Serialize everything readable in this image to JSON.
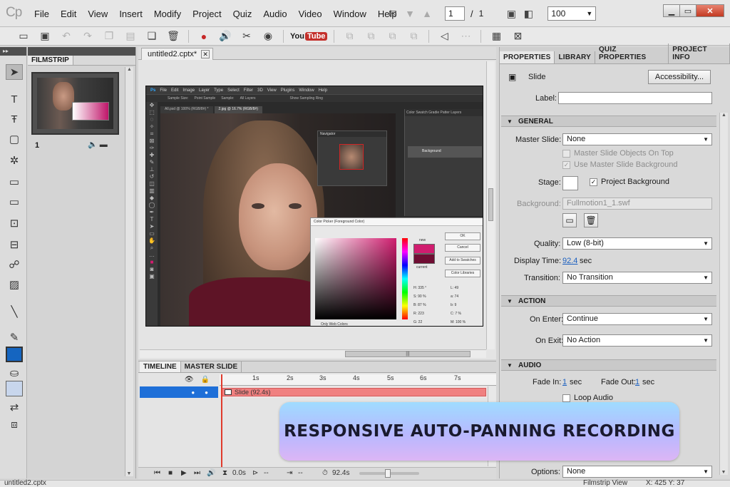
{
  "app": {
    "logo": "Cp",
    "menu": [
      "File",
      "Edit",
      "View",
      "Insert",
      "Modify",
      "Project",
      "Quiz",
      "Audio",
      "Video",
      "Window",
      "Help"
    ],
    "page_current": "1",
    "page_separator": "/",
    "page_total": "1",
    "zoom_value": "100"
  },
  "toolbar": {
    "youtube_label": "You",
    "youtube_badge": "Tube"
  },
  "filmstrip": {
    "tab_label": "FILMSTRIP",
    "slide_number": "1"
  },
  "document": {
    "tab_label": "untitled2.cptx*",
    "close_glyph": "✕",
    "hscroll_grip": "|||"
  },
  "screenshot": {
    "ps_menu": [
      "File",
      "Edit",
      "Image",
      "Layer",
      "Type",
      "Select",
      "Filter",
      "3D",
      "View",
      "Plugins",
      "Window",
      "Help"
    ],
    "ps_options": [
      "Sample Size:",
      "Point Sample",
      "Sample:",
      "All Layers",
      "Show Sampling Ring"
    ],
    "ps_doc_tabs": [
      "All.psd @ 100% (RGB/8#) *",
      "2.jpg @ 16.7% (RGB/8#)"
    ],
    "navigator_title": "Navigator",
    "panel_tabs": "Color  Swatch  Gradie  Patter  Layers",
    "layer_name": "Background",
    "picker_title": "Color Picker (Foreground Color)",
    "picker_new": "new",
    "picker_current": "current",
    "picker_buttons": [
      "OK",
      "Cancel",
      "Add to Swatches",
      "Color Libraries"
    ],
    "picker_fields": [
      "H: 335 °",
      "S: 90 %",
      "B: 87 %",
      "R: 223",
      "G: 22"
    ],
    "picker_fields_right": [
      "L: 49",
      "a: 74",
      "b: 9",
      "C: 7 %",
      "M: 100 %"
    ],
    "picker_web": "Only Web Colors",
    "accent_color": "#d01d6f"
  },
  "timeline": {
    "tabs": [
      "TIMELINE",
      "MASTER SLIDE"
    ],
    "ticks": [
      "1s",
      "2s",
      "3s",
      "4s",
      "5s",
      "6s",
      "7s"
    ],
    "slide_bar_label": "Slide (92.4s)",
    "time_start": "0.0s",
    "time_elapsed": "--",
    "time_end": "--",
    "duration": "92.4s",
    "accent_color": "#1e6fd8"
  },
  "properties": {
    "tabs": [
      "PROPERTIES",
      "LIBRARY",
      "QUIZ PROPERTIES",
      "PROJECT INFO"
    ],
    "object_type": "Slide",
    "accessibility_button": "Accessibility...",
    "label_label": "Label:",
    "label_value": "",
    "general_section": "GENERAL",
    "master_slide_label": "Master Slide:",
    "master_slide_value": "None",
    "master_objects_on_top": "Master Slide Objects On Top",
    "use_master_background": "Use Master Slide Background",
    "stage_label": "Stage:",
    "project_background": "Project Background",
    "background_label": "Background:",
    "background_value": "Fullmotion1_1.swf",
    "quality_label": "Quality:",
    "quality_value": "Low (8-bit)",
    "display_time_label": "Display Time:",
    "display_time_value": "92.4",
    "display_time_unit": "sec",
    "transition_label": "Transition:",
    "transition_value": "No Transition",
    "action_section": "ACTION",
    "on_enter_label": "On Enter:",
    "on_enter_value": "Continue",
    "on_exit_label": "On Exit:",
    "on_exit_value": "No Action",
    "audio_section": "AUDIO",
    "fade_in_label": "Fade In:",
    "fade_in_value": "1",
    "fade_out_label": "Fade Out:",
    "fade_out_value": "1",
    "fade_unit": "sec",
    "loop_audio": "Loop Audio",
    "options_label": "Options:",
    "options_value": "None"
  },
  "status": {
    "file_name": "untitled2.cptx",
    "view_name": "Filmstrip View",
    "coords": "X: 425 Y: 37"
  },
  "banner": {
    "text": "RESPONSIVE AUTO-PANNING RECORDING"
  }
}
